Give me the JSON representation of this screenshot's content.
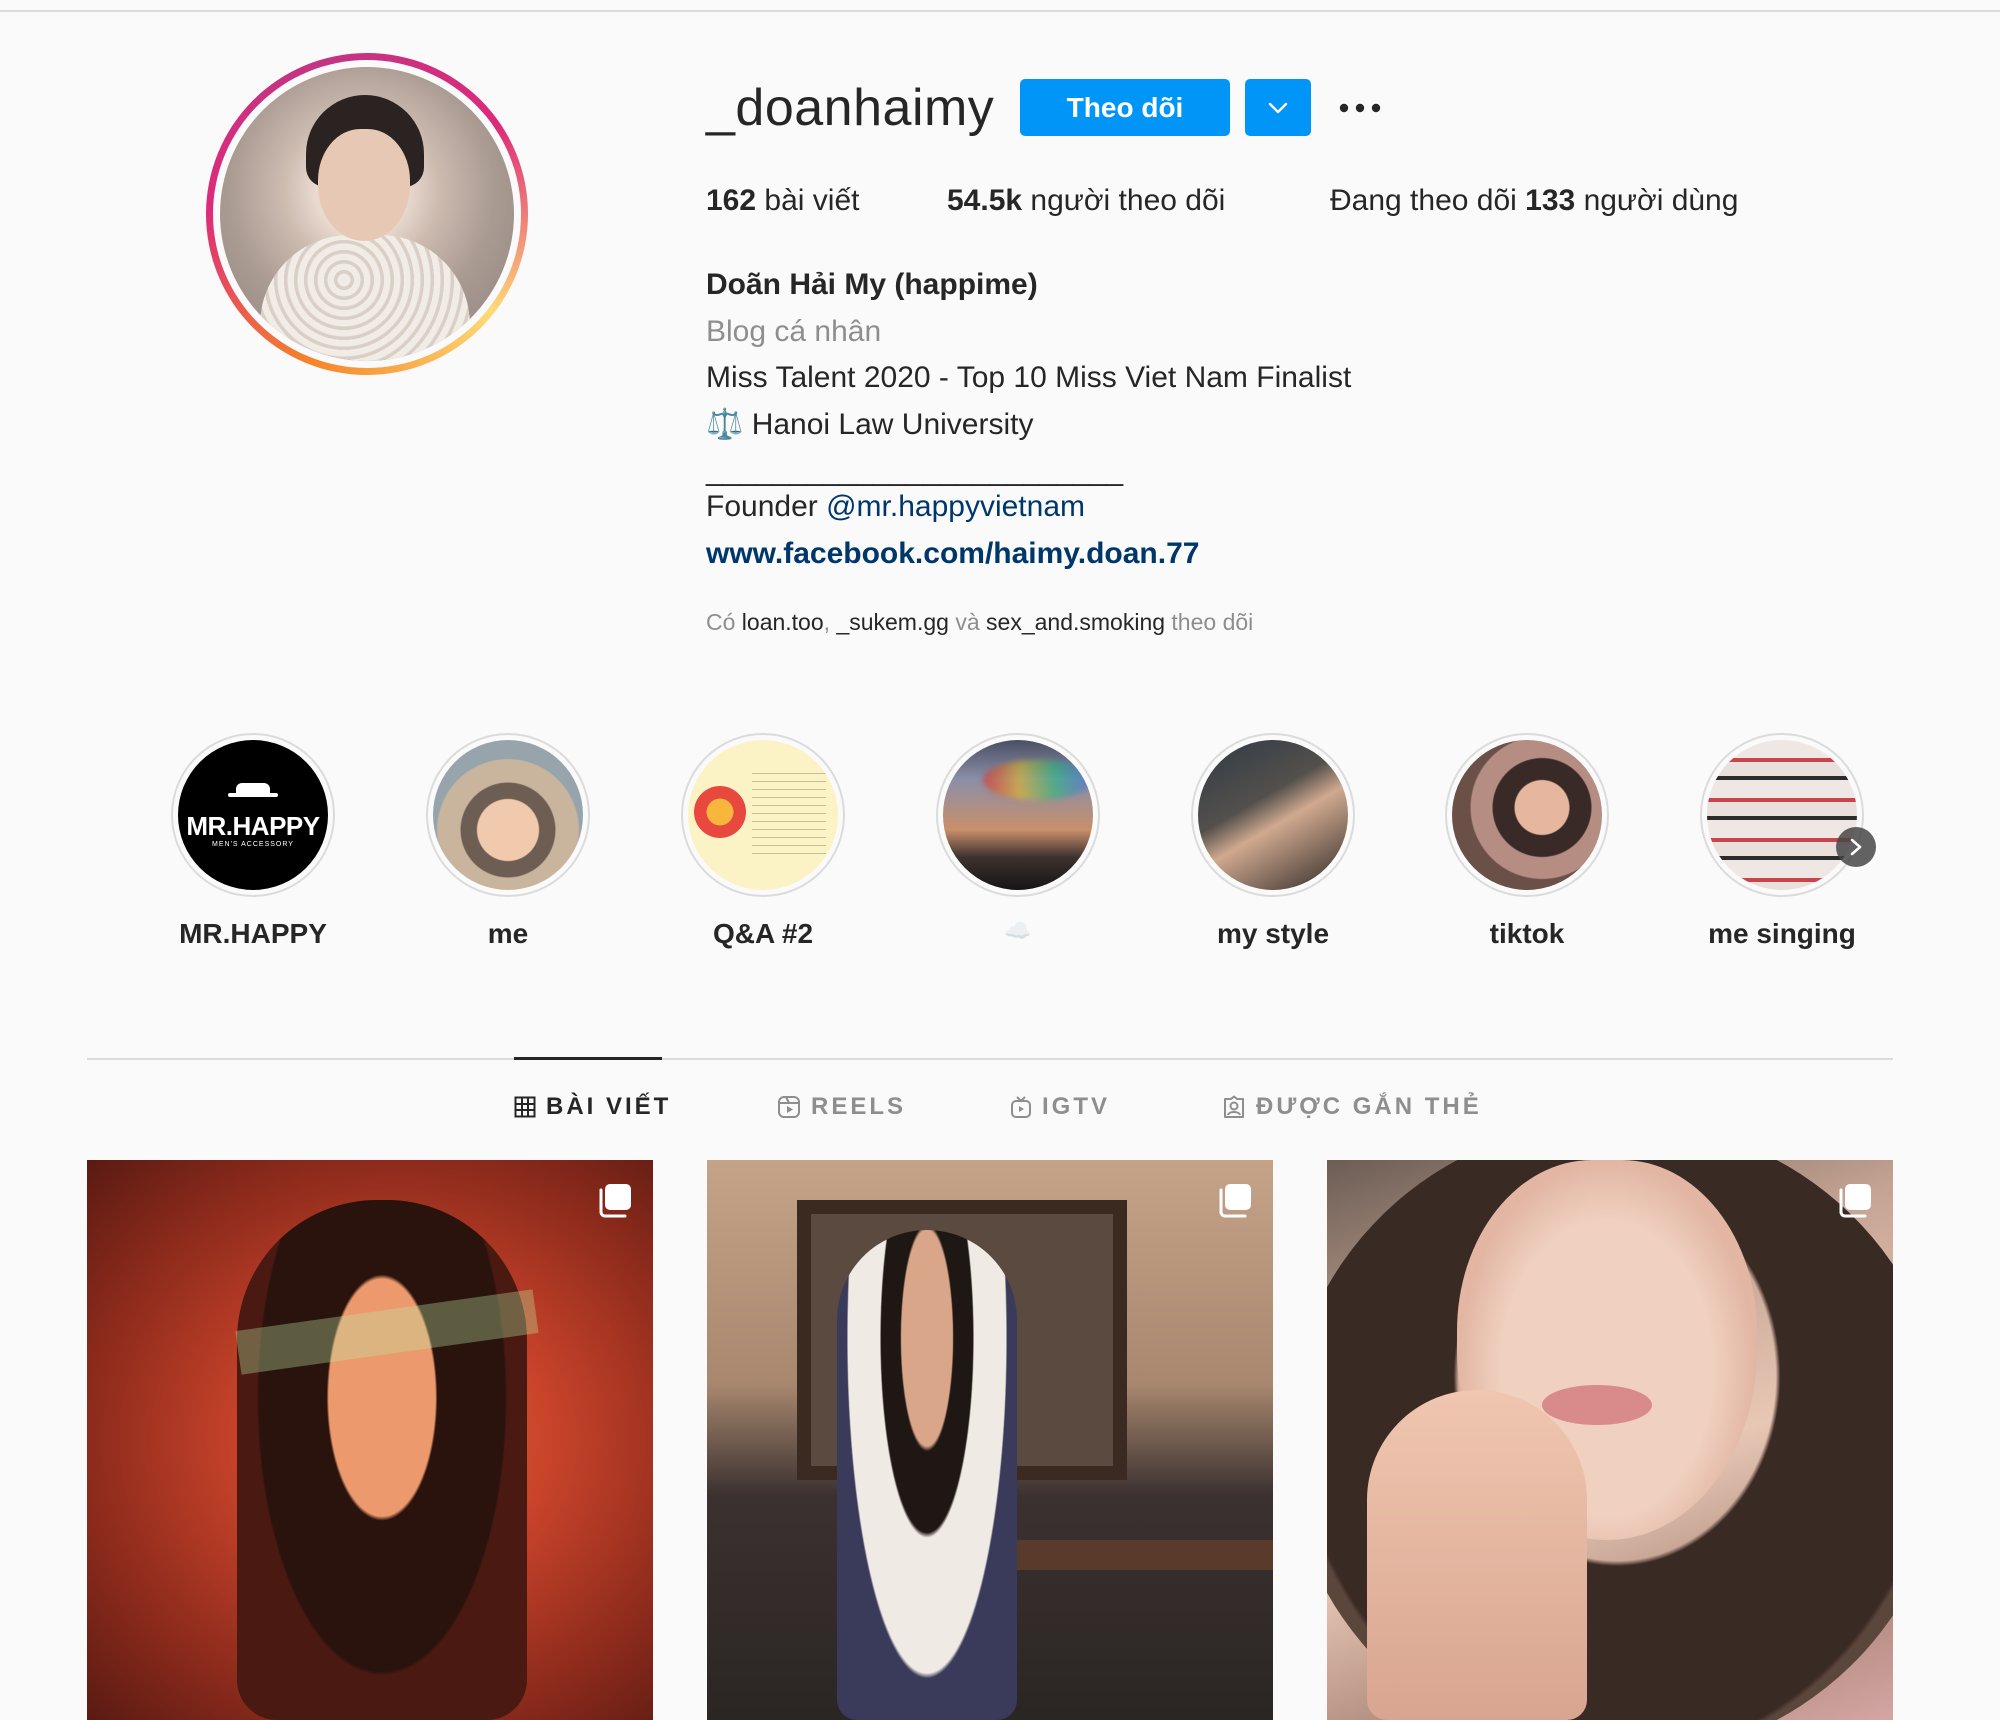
{
  "profile": {
    "username": "_doanhaimy",
    "follow_label": "Theo dõi",
    "stats": {
      "posts_count": "162",
      "posts_label": "bài viết",
      "followers_count": "54.5k",
      "followers_label": "người theo dõi",
      "following_prefix": "Đang theo dõi",
      "following_count": "133",
      "following_suffix": "người dùng"
    },
    "bio": {
      "full_name": "Doãn Hải My (happime)",
      "category": "Blog cá nhân",
      "line1": "Miss Talent 2020 - Top 10 Miss Viet Nam Finalist",
      "line2": "⚖️ Hanoi Law University",
      "separator": "_________________________",
      "founder_prefix": "Founder",
      "founder_mention": "@mr.happyvietnam",
      "website": "www.facebook.com/haimy.doan.77"
    },
    "followed_by": {
      "prefix": "Có",
      "account1": "loan.too",
      "sep1": ",",
      "account2": "_sukem.gg",
      "and": "và",
      "account3": "sex_and.smoking",
      "suffix": "theo dõi"
    }
  },
  "highlights": [
    {
      "label": "MR.HAPPY",
      "logo_text": "MR.HAPPY",
      "logo_sub": "MEN'S ACCESSORY"
    },
    {
      "label": "me"
    },
    {
      "label": "Q&A #2"
    },
    {
      "label": "☁️"
    },
    {
      "label": "my style"
    },
    {
      "label": "tiktok"
    },
    {
      "label": "me singing"
    }
  ],
  "tabs": [
    {
      "label": "BÀI VIẾT",
      "icon": "grid-icon",
      "active": true
    },
    {
      "label": "REELS",
      "icon": "reels-icon",
      "active": false
    },
    {
      "label": "IGTV",
      "icon": "igtv-icon",
      "active": false
    },
    {
      "label": "ĐƯỢC GẮN THẺ",
      "icon": "tagged-icon",
      "active": false
    }
  ],
  "posts": [
    {
      "type": "carousel",
      "icon": "multiple-photos-icon"
    },
    {
      "type": "carousel",
      "icon": "multiple-photos-icon"
    },
    {
      "type": "carousel",
      "icon": "multiple-photos-icon"
    }
  ],
  "colors": {
    "accent": "#0095f6",
    "link": "#00376b",
    "text": "#262626",
    "muted": "#8e8e8e",
    "background": "#fafafa",
    "divider": "#dbdbdb"
  }
}
